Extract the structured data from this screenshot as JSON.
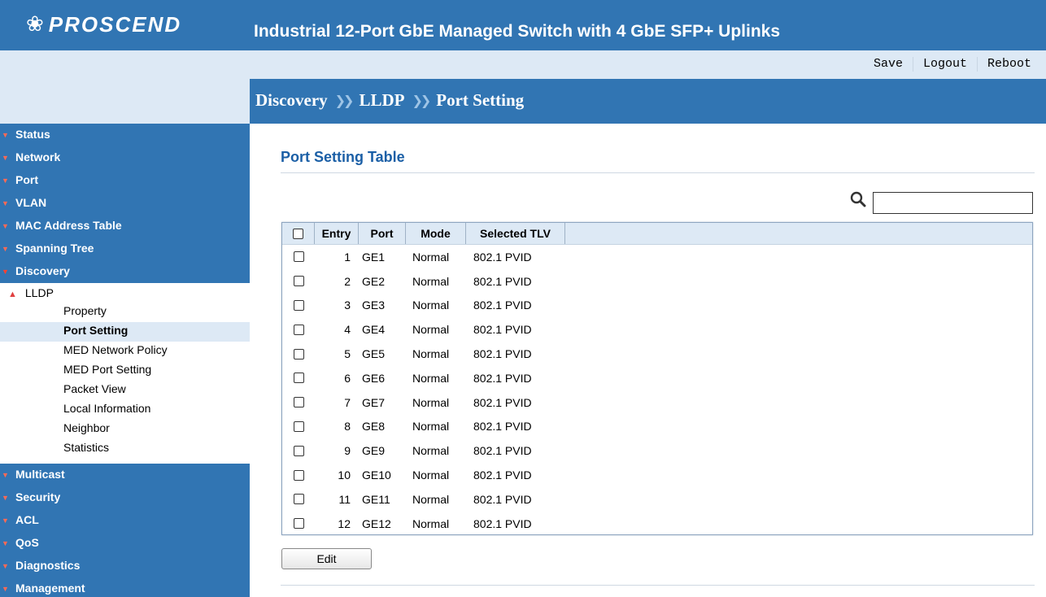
{
  "header": {
    "brand": "PROSCEND",
    "logo_icon": "proscend-logo-icon",
    "product_title": "Industrial 12-Port GbE Managed Switch with 4 GbE SFP+ Uplinks"
  },
  "actions": {
    "save": "Save",
    "logout": "Logout",
    "reboot": "Reboot"
  },
  "breadcrumb": [
    "Discovery",
    "LLDP",
    "Port Setting"
  ],
  "sidebar": {
    "top_items": [
      "Status",
      "Network",
      "Port",
      "VLAN",
      "MAC Address Table",
      "Spanning Tree",
      "Discovery"
    ],
    "lldp_label": "LLDP",
    "lldp_items": [
      "Property",
      "Port Setting",
      "MED Network Policy",
      "MED Port Setting",
      "Packet View",
      "Local Information",
      "Neighbor",
      "Statistics"
    ],
    "active_item": "Port Setting",
    "bottom_items": [
      "Multicast",
      "Security",
      "ACL",
      "QoS",
      "Diagnostics",
      "Management"
    ]
  },
  "main": {
    "title": "Port Setting Table",
    "search": {
      "value": "",
      "placeholder": ""
    },
    "columns": [
      "Entry",
      "Port",
      "Mode",
      "Selected TLV"
    ],
    "rows": [
      {
        "entry": "1",
        "port": "GE1",
        "mode": "Normal",
        "tlv": "802.1 PVID"
      },
      {
        "entry": "2",
        "port": "GE2",
        "mode": "Normal",
        "tlv": "802.1 PVID"
      },
      {
        "entry": "3",
        "port": "GE3",
        "mode": "Normal",
        "tlv": "802.1 PVID"
      },
      {
        "entry": "4",
        "port": "GE4",
        "mode": "Normal",
        "tlv": "802.1 PVID"
      },
      {
        "entry": "5",
        "port": "GE5",
        "mode": "Normal",
        "tlv": "802.1 PVID"
      },
      {
        "entry": "6",
        "port": "GE6",
        "mode": "Normal",
        "tlv": "802.1 PVID"
      },
      {
        "entry": "7",
        "port": "GE7",
        "mode": "Normal",
        "tlv": "802.1 PVID"
      },
      {
        "entry": "8",
        "port": "GE8",
        "mode": "Normal",
        "tlv": "802.1 PVID"
      },
      {
        "entry": "9",
        "port": "GE9",
        "mode": "Normal",
        "tlv": "802.1 PVID"
      },
      {
        "entry": "10",
        "port": "GE10",
        "mode": "Normal",
        "tlv": "802.1 PVID"
      },
      {
        "entry": "11",
        "port": "GE11",
        "mode": "Normal",
        "tlv": "802.1 PVID"
      },
      {
        "entry": "12",
        "port": "GE12",
        "mode": "Normal",
        "tlv": "802.1 PVID"
      }
    ],
    "edit_label": "Edit"
  },
  "colors": {
    "header_blue": "#3175b3",
    "light_blue": "#dde9f5",
    "title_blue": "#1b5fa6",
    "chevron_red": "#ff6a55"
  }
}
